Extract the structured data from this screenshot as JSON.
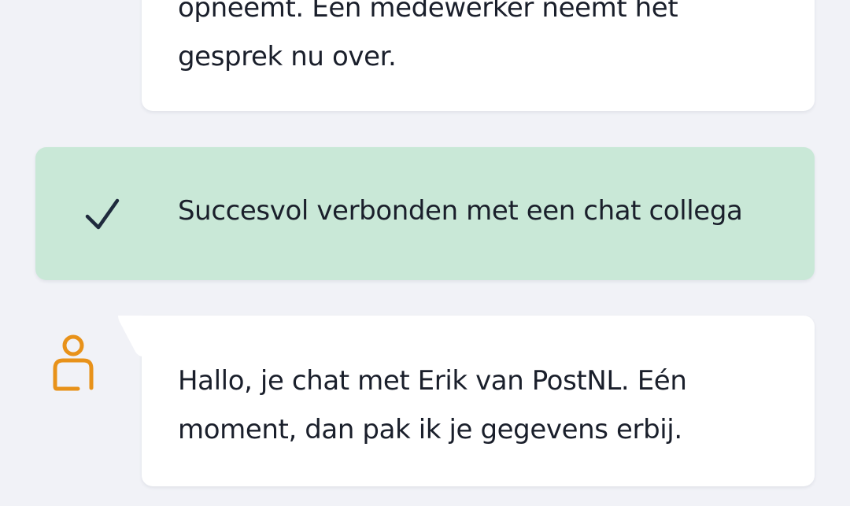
{
  "messages": [
    {
      "role": "system",
      "text": "opneemt. Een medewerker neemt het gesprek nu over."
    },
    {
      "role": "agent",
      "text": "Hallo, je chat met Erik van PostNL. Eén moment, dan pak ik je gegevens erbij."
    }
  ],
  "status": {
    "icon": "checkmark-icon",
    "text": "Succesvol verbonden met een chat collega",
    "background": "#c9e8d7"
  },
  "agent": {
    "avatar_icon": "person-icon",
    "accent_color": "#e8921a"
  },
  "colors": {
    "page_background": "#f1f2f7",
    "bubble_background": "#ffffff",
    "text": "#1a1f2b"
  }
}
